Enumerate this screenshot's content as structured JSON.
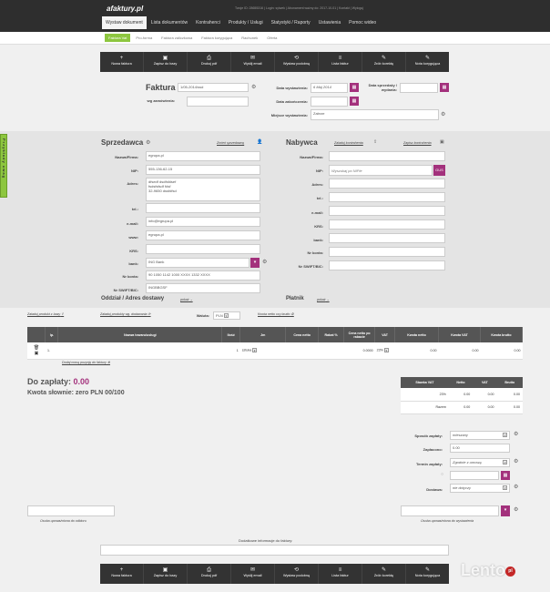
{
  "header": {
    "logo": "afaktury.pl",
    "info": "Twoje ID: 28655316 | Login: sylwek | Abonament ważny do: 2017-10-01 | Kontakt | Wyloguj",
    "nav": [
      "Wystaw dokument",
      "Lista dokumentów",
      "Kontrahenci",
      "Produkty / Usługi",
      "Statystyki / Raporty",
      "Ustawienia",
      "Pomoc wideo"
    ]
  },
  "subnav": [
    "Faktura Vat",
    "Pro-forma",
    "Faktura zaliczkowa",
    "Faktura korygująca",
    "Rachunek",
    "Oferta"
  ],
  "toolbar": [
    {
      "icon": "+",
      "label": "Nowa faktura"
    },
    {
      "icon": "▣",
      "label": "Zapisz do bazy"
    },
    {
      "icon": "⎙",
      "label": "Drukuj pdf"
    },
    {
      "icon": "✉",
      "label": "Wyślij email"
    },
    {
      "icon": "⟲",
      "label": "Wystaw podobną"
    },
    {
      "icon": "≡",
      "label": "Lista faktur"
    },
    {
      "icon": "✎",
      "label": "Zrób korektę"
    },
    {
      "icon": "✎",
      "label": "Nota korygująca"
    }
  ],
  "invoice": {
    "title": "Faktura nr",
    "number": "1/05-2014/ssd",
    "order_label": "wg zamówienia:",
    "issue_label": "Data wystawienia:",
    "issue_value": "6 Maj 2014",
    "sale_label": "Data sprzedaży / wydania:",
    "end_label": "Data zakończenia:",
    "place_label": "Miejsce wystawienia:",
    "place_value": "Zabrze"
  },
  "side_tab": "Przykłady uwag",
  "seller": {
    "title": "Sprzedawca",
    "change_link": "Zmień sprzedawcę",
    "labels": [
      "Nazwa/Firma:",
      "NIP:",
      "Adres:",
      "tel.:",
      "e-mail:",
      "www:",
      "KRS:",
      "bank:",
      "Nr konta:",
      "Nr SWIFT/BIC:"
    ],
    "name": "egrupa.pl",
    "nip": "555-136-62-15",
    "address": "dfsedf dsdfsfdsef\nfsdsfsfsdf fdsf\n32-9650 dssfdfsd",
    "tel": "",
    "email": "info@egrupa.pl",
    "www": "egrupa.pl",
    "krs": "",
    "bank": "ING Bank",
    "account": "90 1050 1142 1000 XXXX 1332 XXXX",
    "swift": "INGBBGSF",
    "dept_label": "Oddział / Adres dostawy",
    "dept_link": "pokaż"
  },
  "buyer": {
    "title": "Nabywca",
    "add_link": "Zaladuj kontrahenta",
    "save_link": "Zapisz kontrahenta",
    "labels": [
      "Nazwa/Firma:",
      "NIP:",
      "Adres:",
      "tel.:",
      "e-mail:",
      "KRS:",
      "bank:",
      "Nr konta:",
      "Nr SWIFT/BIC:"
    ],
    "nip_placeholder": "Wyszukaj po NIPie",
    "gus": "GUS",
    "payer_label": "Płatnik",
    "payer_link": "pokaż"
  },
  "items_bar": {
    "load_link": "Załaduj produkt z bazy",
    "group_link": "Załaduj produkty wg. dodawania",
    "currency_label": "Waluta:",
    "currency": "PLN",
    "gross_link": "Kwota netto czy brutto"
  },
  "items_table": {
    "headers": [
      "",
      "lp.",
      "Nazwa towaru/usługi",
      "Ilość",
      "Jm",
      "Cena netto",
      "Rabat %",
      "Cena netto po rabacie",
      "VAT",
      "Kwota netto",
      "Kwota VAT",
      "Kwota brutto"
    ],
    "row": {
      "lp": "1.",
      "name": "",
      "qty": "1",
      "unit": "sztuka",
      "price": "",
      "discount": "",
      "net_after": "0.0000",
      "vat": "23%",
      "net": "0.00",
      "vat_amount": "0.00",
      "gross": "0.00"
    },
    "add_link": "Dodaj nową pozycję do faktury"
  },
  "totals": {
    "to_pay_label": "Do zapłaty:",
    "to_pay_value": "0.00",
    "words": "Kwota słownie: zero PLN 00/100"
  },
  "vat_table": {
    "headers": [
      "Stawka VAT",
      "Netto",
      "VAT",
      "Brutto"
    ],
    "rows": [
      [
        "23%",
        "0.00",
        "0.00",
        "0.00"
      ],
      [
        "Razem",
        "0.00",
        "0.00",
        "0.00"
      ]
    ]
  },
  "payment": {
    "method_label": "Sposób zapłaty:",
    "method_value": "mieszany",
    "paid_label": "Zapłacono:",
    "paid_value": "0.00",
    "term_label": "Termin zapłaty:",
    "term_value": "Zgodnie z umową",
    "delivery_label": "Dostawa:",
    "delivery_value": "nie dotyczy"
  },
  "signatures": {
    "receiver": "Osoba upoważniona do odbioru",
    "issuer": "Osoba upoważniona do wystawienia"
  },
  "extra_info_label": "Dodatkowe informacje do faktury:",
  "watermark": "Lento",
  "watermark_tld": "pl"
}
